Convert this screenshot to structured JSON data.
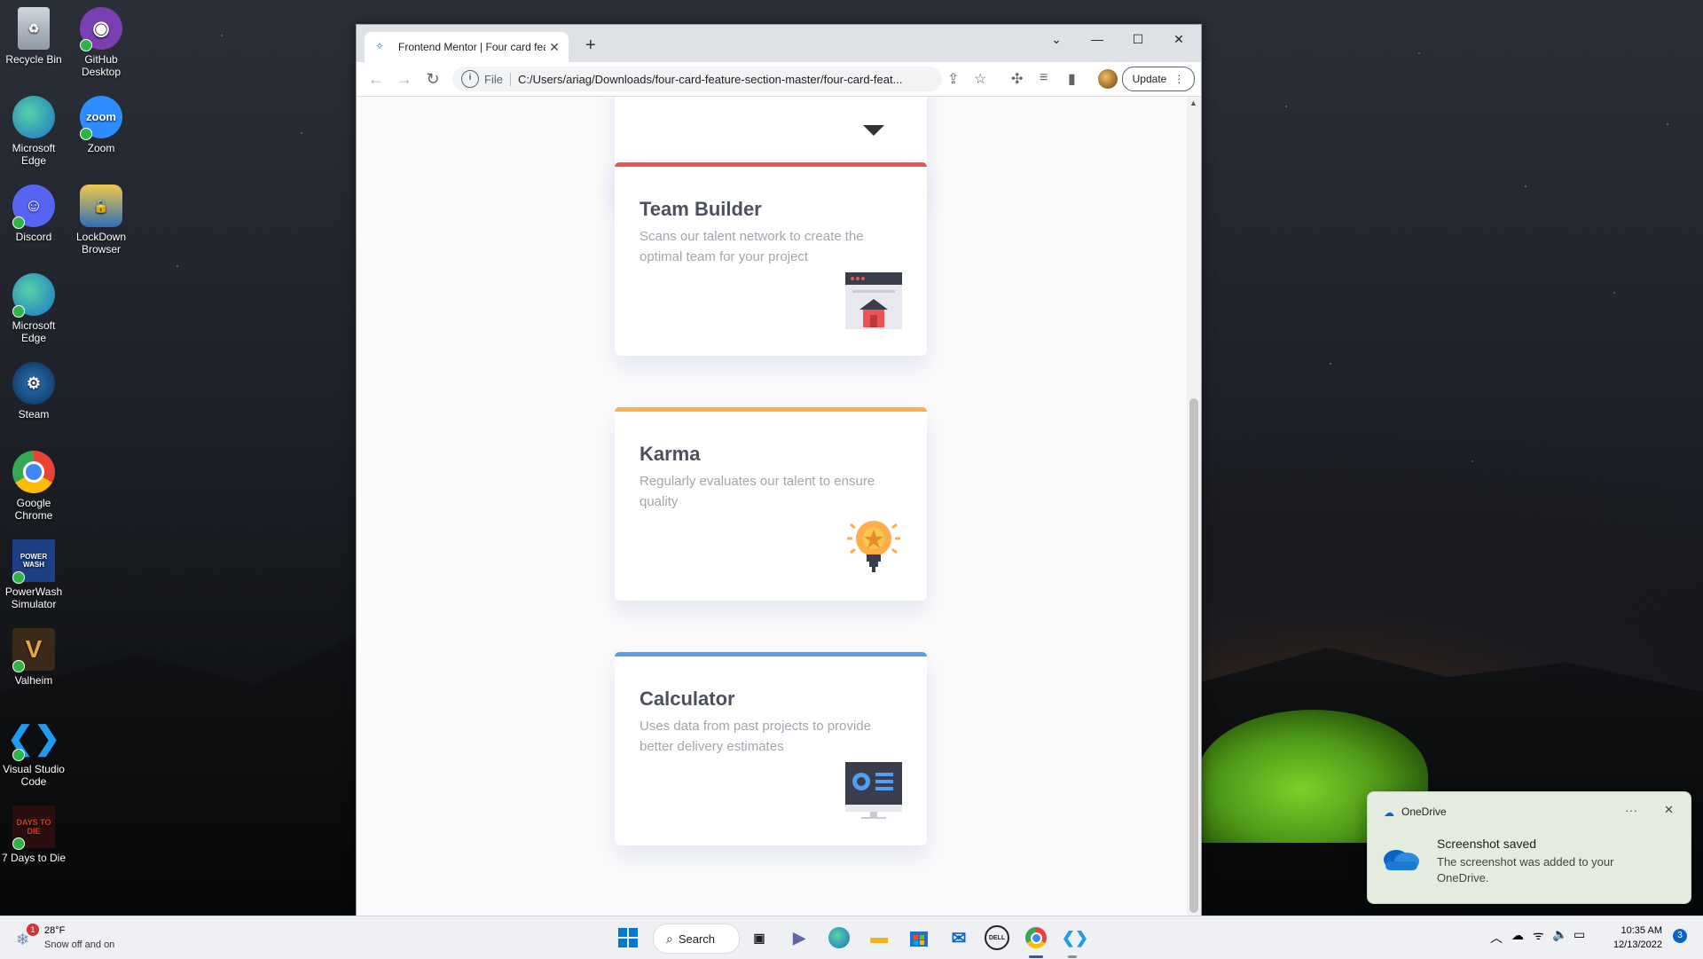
{
  "desktop": {
    "icons": [
      {
        "label": "Recycle Bin",
        "icon": "recycle-bin-icon"
      },
      {
        "label": "GitHub Desktop",
        "icon": "github-desktop-icon"
      },
      {
        "label": "Microsoft Edge",
        "icon": "edge-icon"
      },
      {
        "label": "Zoom",
        "icon": "zoom-icon",
        "glyph": "zoom"
      },
      {
        "label": "Discord",
        "icon": "discord-icon"
      },
      {
        "label": "LockDown Browser",
        "icon": "lockdown-browser-icon"
      },
      {
        "label": "Microsoft Edge",
        "icon": "edge-icon"
      },
      {
        "label": "Steam",
        "icon": "steam-icon"
      },
      {
        "label": "Google Chrome",
        "icon": "chrome-icon"
      },
      {
        "label": "PowerWash Simulator",
        "icon": "powerwash-icon",
        "glyph": "POWER WASH"
      },
      {
        "label": "Valheim",
        "icon": "valheim-icon",
        "glyph": "V"
      },
      {
        "label": "Visual Studio Code",
        "icon": "vscode-icon"
      },
      {
        "label": "7 Days to Die",
        "icon": "7-days-to-die-icon",
        "glyph": "DAYS TO DIE"
      }
    ]
  },
  "browser": {
    "tab_title": "Frontend Mentor | Four card feat",
    "new_tab": "+",
    "address_prefix": "File",
    "url": "C:/Users/ariag/Downloads/four-card-feature-section-master/four-card-feat...",
    "update_label": "Update",
    "icons": {
      "back": "back-arrow-icon",
      "forward": "forward-arrow-icon",
      "reload": "reload-icon",
      "share": "share-icon",
      "bookmark": "star-icon",
      "extensions": "puzzle-icon",
      "media": "media-queue-icon",
      "sidepanel": "side-panel-icon"
    }
  },
  "page": {
    "cards": [
      {
        "title": "Team Builder",
        "description": "Scans our talent network to create the optimal team for your project",
        "accent": "#ea5454",
        "icon": "team-builder-icon"
      },
      {
        "title": "Karma",
        "description": "Regularly evaluates our talent to ensure quality",
        "accent": "#fcae4a",
        "icon": "lightbulb-icon"
      },
      {
        "title": "Calculator",
        "description": "Uses data from past projects to provide better delivery estimates",
        "accent": "#549ef2",
        "icon": "calculator-icon"
      }
    ]
  },
  "taskbar": {
    "weather": {
      "temp": "28°F",
      "condition": "Snow off and on",
      "badge": "1"
    },
    "search_label": "Search",
    "apps": [
      "start-icon",
      "task-view-icon",
      "chat-icon",
      "edge-icon",
      "file-explorer-icon",
      "store-icon",
      "mail-icon",
      "dell-icon",
      "chrome-icon",
      "vscode-icon"
    ],
    "dell_label": "DELL",
    "clock": {
      "time": "10:35 AM",
      "date": "12/13/2022"
    },
    "notification_count": "3"
  },
  "toast": {
    "app": "OneDrive",
    "more": "···",
    "heading": "Screenshot saved",
    "body": "The screenshot was added to your OneDrive."
  }
}
